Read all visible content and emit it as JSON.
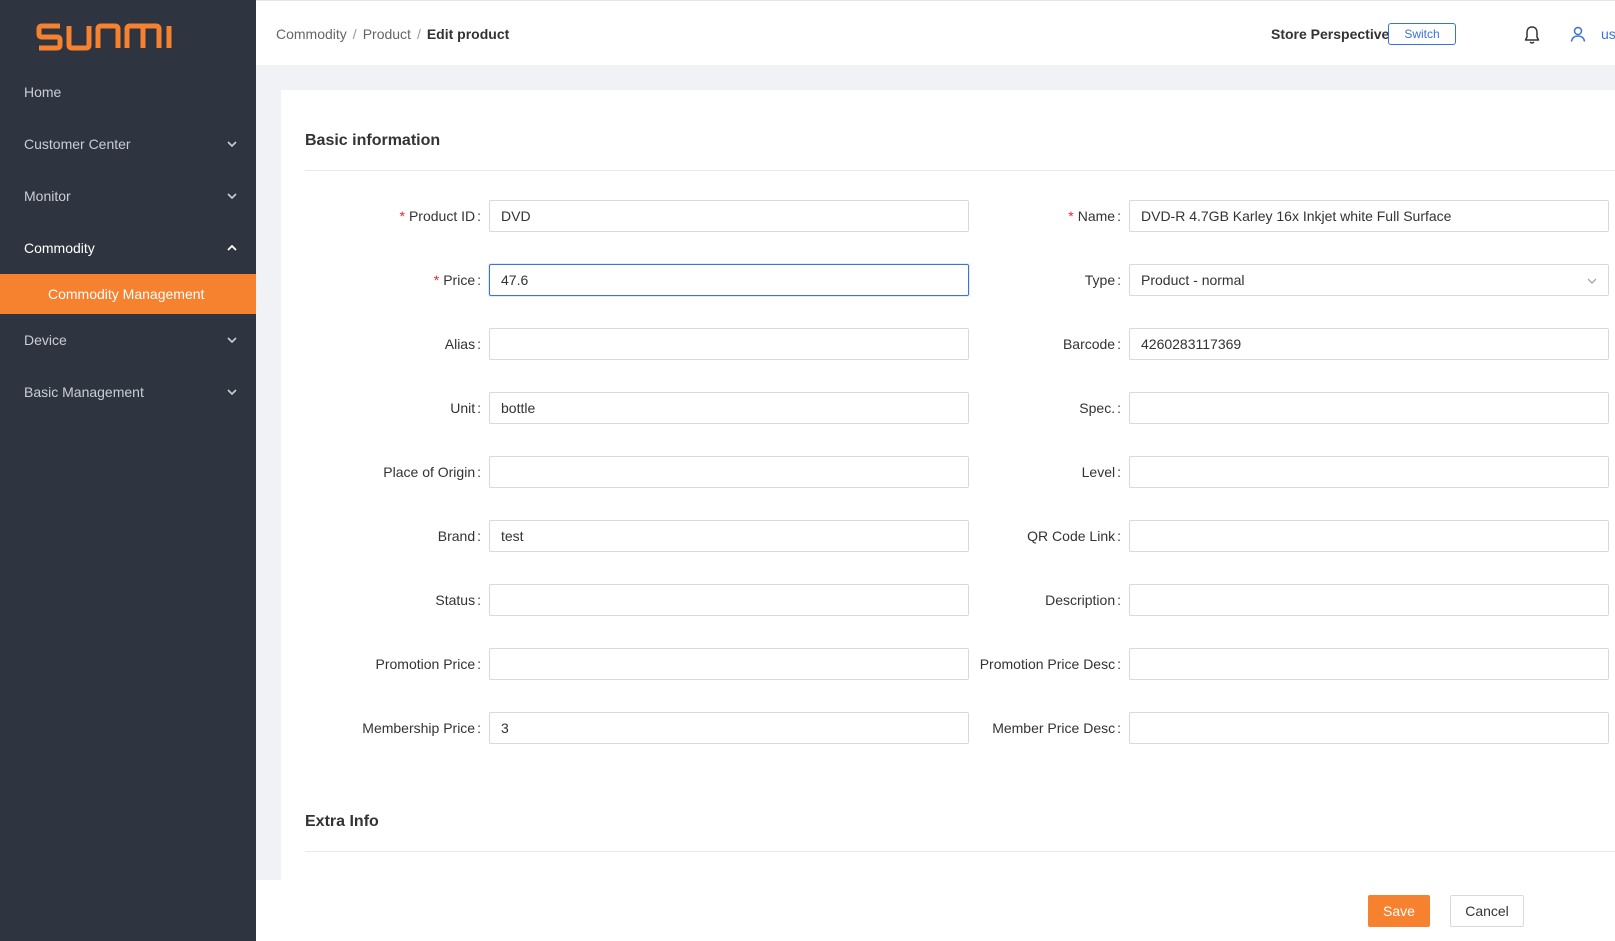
{
  "brand": {
    "logo_text": "SUNMI",
    "accent_color": "#f6812f",
    "sidebar_bg": "#2f3540",
    "link_color": "#3a73d8"
  },
  "sidebar": {
    "items": [
      {
        "label": "Home",
        "icon": "none"
      },
      {
        "label": "Customer Center",
        "icon": "chevron-down-icon"
      },
      {
        "label": "Monitor",
        "icon": "chevron-down-icon"
      },
      {
        "label": "Commodity",
        "icon": "chevron-up-icon",
        "expanded": true
      },
      {
        "label": "Device",
        "icon": "chevron-down-icon"
      },
      {
        "label": "Basic Management",
        "icon": "chevron-down-icon"
      }
    ],
    "submenu": {
      "label": "Commodity Management",
      "active": true
    }
  },
  "header": {
    "breadcrumb": [
      "Commodity",
      "Product",
      "Edit product"
    ],
    "breadcrumb_separator": "/",
    "store_label": "Store Perspective",
    "switch_label": "Switch",
    "user_name": "us"
  },
  "form": {
    "section_basic": "Basic information",
    "section_extra": "Extra Info",
    "fields": {
      "product_id": {
        "label": "Product ID",
        "required": true,
        "value": "DVD"
      },
      "name": {
        "label": "Name",
        "required": true,
        "value": "DVD-R 4.7GB Karley 16x Inkjet white Full Surface"
      },
      "price": {
        "label": "Price",
        "required": true,
        "value": "47.6"
      },
      "type": {
        "label": "Type",
        "value": "Product - normal"
      },
      "alias": {
        "label": "Alias",
        "value": ""
      },
      "barcode": {
        "label": "Barcode",
        "value": "4260283117369"
      },
      "unit": {
        "label": "Unit",
        "value": "bottle"
      },
      "spec": {
        "label": "Spec.",
        "value": ""
      },
      "place_of_origin": {
        "label": "Place of Origin",
        "value": ""
      },
      "level": {
        "label": "Level",
        "value": ""
      },
      "brand": {
        "label": "Brand",
        "value": "test"
      },
      "qr_code_link": {
        "label": "QR Code Link",
        "value": ""
      },
      "status": {
        "label": "Status",
        "value": ""
      },
      "description": {
        "label": "Description",
        "value": ""
      },
      "promotion_price": {
        "label": "Promotion Price",
        "value": ""
      },
      "promotion_price_desc": {
        "label": "Promotion Price Desc",
        "value": ""
      },
      "membership_price": {
        "label": "Membership Price",
        "value": "3"
      },
      "member_price_desc": {
        "label": "Member Price Desc",
        "value": ""
      }
    },
    "colon": ":"
  },
  "actions": {
    "save_label": "Save",
    "cancel_label": "Cancel"
  }
}
